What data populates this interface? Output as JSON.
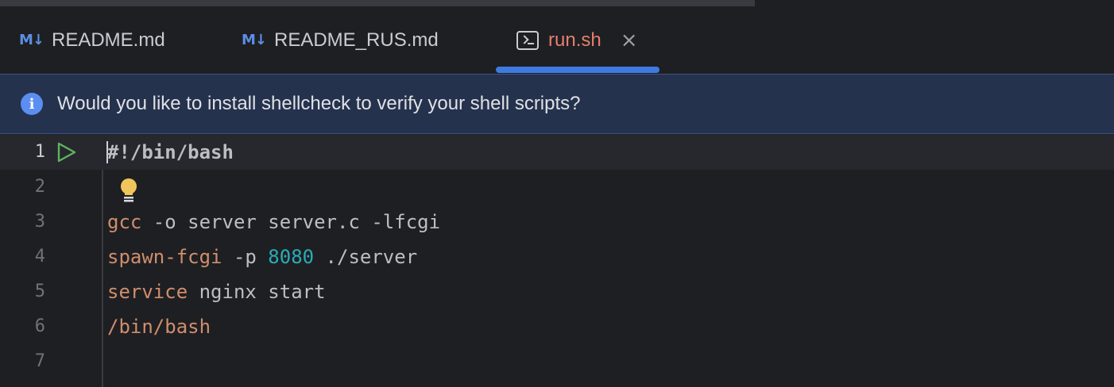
{
  "tabs": [
    {
      "icon": "M↓",
      "label": "README.md"
    },
    {
      "icon": "M↓",
      "label": "README_RUS.md"
    },
    {
      "label": "run.sh",
      "close": "×"
    }
  ],
  "banner": {
    "text": "Would you like to install shellcheck to verify your shell scripts?"
  },
  "editor": {
    "lines": [
      {
        "number": "1",
        "tokens": [
          {
            "text": "#!/bin/bash",
            "type": "shebang"
          }
        ]
      },
      {
        "number": "2",
        "tokens": []
      },
      {
        "number": "3",
        "tokens": [
          {
            "text": "gcc",
            "type": "kw"
          },
          {
            "text": " -o server server.c -lfcgi",
            "type": "plain"
          }
        ]
      },
      {
        "number": "4",
        "tokens": [
          {
            "text": "spawn-fcgi",
            "type": "kw"
          },
          {
            "text": " -p ",
            "type": "plain"
          },
          {
            "text": "8080",
            "type": "num"
          },
          {
            "text": " ./server",
            "type": "plain"
          }
        ]
      },
      {
        "number": "5",
        "tokens": [
          {
            "text": "service",
            "type": "kw"
          },
          {
            "text": " nginx start",
            "type": "plain"
          }
        ]
      },
      {
        "number": "6",
        "tokens": [
          {
            "text": "/bin/bash",
            "type": "kw"
          }
        ]
      },
      {
        "number": "7",
        "tokens": []
      }
    ]
  },
  "colors": {
    "accent": "#3d7be3",
    "active_tab_text": "#e57e6e",
    "keyword": "#cf8e6d",
    "number": "#2aacb8",
    "run_icon": "#5fb35f",
    "bulb": "#f2c55c"
  }
}
